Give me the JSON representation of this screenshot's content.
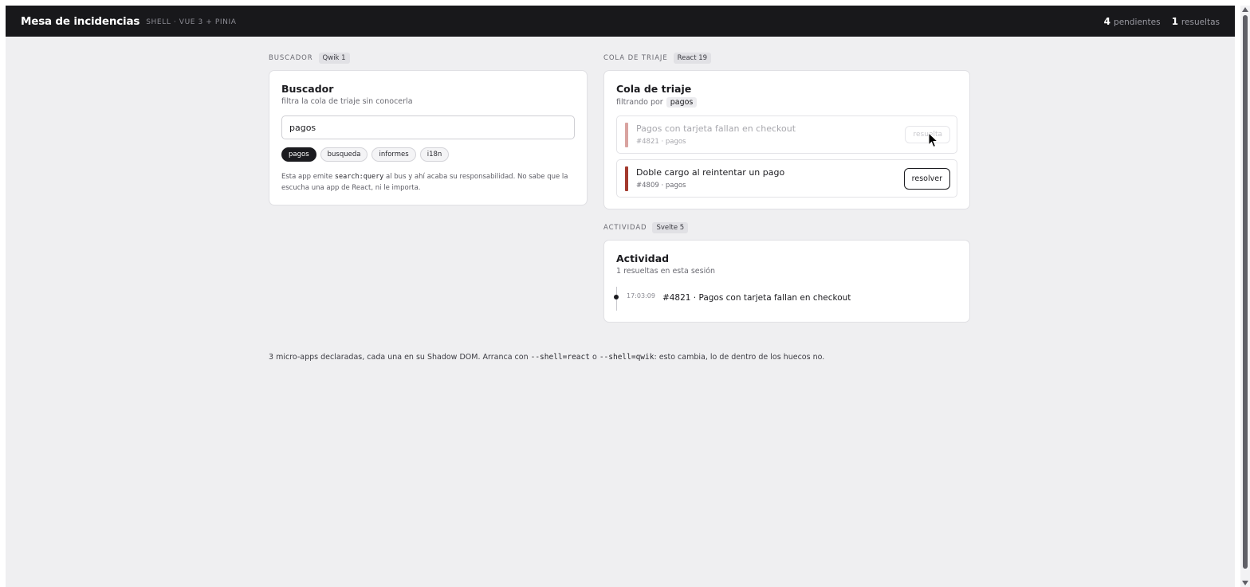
{
  "header": {
    "title": "Mesa de incidencias",
    "subtitle": "SHELL · VUE 3 + PINIA",
    "pending_count": "4",
    "pending_label": "pendientes",
    "resolved_count": "1",
    "resolved_label": "resueltas"
  },
  "search_panel": {
    "section_label": "BUSCADOR",
    "framework": "Qwik 1",
    "title": "Buscador",
    "subtitle": "filtra la cola de triaje sin conocerla",
    "input_value": "pagos",
    "tags": [
      "pagos",
      "busqueda",
      "informes",
      "i18n"
    ],
    "active_tag": "pagos",
    "note_before": "Esta app emite ",
    "note_code": "search:query",
    "note_after": " al bus y ahí acaba su responsabilidad. No sabe que la escucha una app de React, ni le importa."
  },
  "triage_panel": {
    "section_label": "COLA DE TRIAJE",
    "framework": "React 19",
    "title": "Cola de triaje",
    "filter_prefix": "filtrando por",
    "filter_value": "pagos",
    "issues": [
      {
        "title": "Pagos con tarjeta fallan en checkout",
        "meta": "#4821 · pagos",
        "button": "resuelta",
        "state": "resolved",
        "color": "#d9a3a0"
      },
      {
        "title": "Doble cargo al reintentar un pago",
        "meta": "#4809 · pagos",
        "button": "resolver",
        "state": "open",
        "color": "#a33a2e"
      }
    ]
  },
  "activity_panel": {
    "section_label": "ACTIVIDAD",
    "framework": "Svelte 5",
    "title": "Actividad",
    "subtitle": "1 resueltas en esta sesión",
    "entries": [
      {
        "time": "17:03:09",
        "text": "#4821 · Pagos con tarjeta fallan en checkout"
      }
    ]
  },
  "footer": {
    "text_1": "3 micro-apps declaradas, cada una en su Shadow DOM. Arranca con ",
    "code_1": "--shell=react",
    "text_2": " o ",
    "code_2": "--shell=qwik",
    "text_3": ": esto cambia, lo de dentro de los huecos no."
  }
}
